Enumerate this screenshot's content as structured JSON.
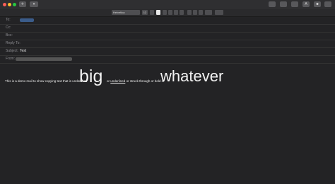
{
  "titlebar": {
    "send_label": "✈",
    "attach_label": "▾",
    "right_buttons": [
      "A",
      "☻"
    ]
  },
  "format": {
    "font": "Helvetica",
    "size_label": "12"
  },
  "headers": {
    "to_label": "To:",
    "cc_label": "Cc:",
    "bcc_label": "Bcc:",
    "replyto_label": "Reply To:",
    "subject_label": "Subject:",
    "subject_value": "Test",
    "from_label": "From:"
  },
  "body": {
    "line_start": "This is a demo mail to show copying text that is underlined",
    "big_word": "big",
    "mid_text": "or",
    "underlined": "underlined",
    "rest": "or struck through or bold or",
    "whatever_word": "whatever"
  }
}
